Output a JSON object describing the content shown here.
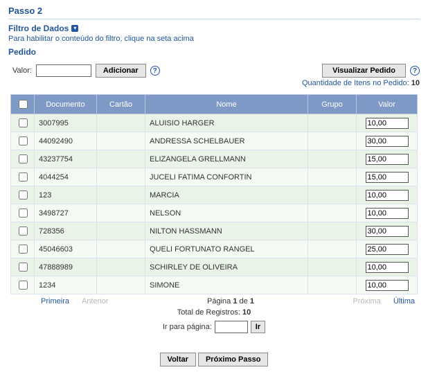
{
  "step_title": "Passo 2",
  "filter": {
    "title": "Filtro de Dados",
    "help_text": "Para habilitar o conteúdo do filtro, clique na seta acima"
  },
  "section_title": "Pedido",
  "valor_input": {
    "label": "Valor:",
    "value": ""
  },
  "buttons": {
    "add": "Adicionar",
    "view_order": "Visualizar Pedido",
    "back": "Voltar",
    "next_step": "Próximo Passo",
    "go": "Ir"
  },
  "qty_line": {
    "label": "Quantidade de Itens no Pedido:",
    "value": "10"
  },
  "table": {
    "headers": {
      "documento": "Documento",
      "cartao": "Cartão",
      "nome": "Nome",
      "grupo": "Grupo",
      "valor": "Valor"
    },
    "rows": [
      {
        "documento": "3007995",
        "cartao": "",
        "nome": "ALUISIO HARGER",
        "grupo": "",
        "valor": "10,00"
      },
      {
        "documento": "44092490",
        "cartao": "",
        "nome": "ANDRESSA SCHELBAUER",
        "grupo": "",
        "valor": "30,00"
      },
      {
        "documento": "43237754",
        "cartao": "",
        "nome": "ELIZANGELA GRELLMANN",
        "grupo": "",
        "valor": "15,00"
      },
      {
        "documento": "4044254",
        "cartao": "",
        "nome": "JUCELI FATIMA CONFORTIN",
        "grupo": "",
        "valor": "15,00"
      },
      {
        "documento": "123",
        "cartao": "",
        "nome": "MARCIA",
        "grupo": "",
        "valor": "10,00"
      },
      {
        "documento": "3498727",
        "cartao": "",
        "nome": "NELSON",
        "grupo": "",
        "valor": "10,00"
      },
      {
        "documento": "728356",
        "cartao": "",
        "nome": "NILTON HASSMANN",
        "grupo": "",
        "valor": "30,00"
      },
      {
        "documento": "45046603",
        "cartao": "",
        "nome": "QUELI FORTUNATO RANGEL",
        "grupo": "",
        "valor": "25,00"
      },
      {
        "documento": "47888989",
        "cartao": "",
        "nome": "SCHIRLEY DE OLIVEIRA",
        "grupo": "",
        "valor": "10,00"
      },
      {
        "documento": "1234",
        "cartao": "",
        "nome": "SIMONE",
        "grupo": "",
        "valor": "10,00"
      }
    ]
  },
  "pager": {
    "first": "Primeira",
    "prev": "Anterior",
    "page_prefix": "Página ",
    "page_current": "1",
    "page_of": " de ",
    "page_total": "1",
    "next": "Próxima",
    "last": "Última",
    "total_prefix": "Total de Registros: ",
    "total_value": "10",
    "goto_label": "Ir para página:",
    "goto_value": ""
  }
}
